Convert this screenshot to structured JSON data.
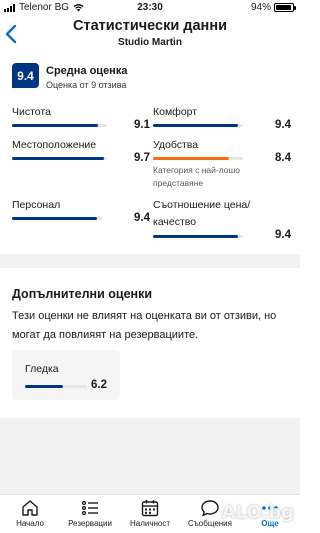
{
  "status_bar": {
    "carrier": "Telenor BG",
    "time": "23:30",
    "battery": "94%",
    "battery_level": 0.94
  },
  "header": {
    "title": "Статистически данни",
    "subtitle": "Studio Martin"
  },
  "average": {
    "score": "9.4",
    "title": "Средна оценка",
    "subtitle": "Оценка от 9 отзива"
  },
  "categories": [
    {
      "label": "Чистота",
      "value": "9.1",
      "fraction": 0.91,
      "color": "#003580"
    },
    {
      "label": "Комфорт",
      "value": "9.4",
      "fraction": 0.94,
      "color": "#003580"
    },
    {
      "label": "Местоположение",
      "value": "9.7",
      "fraction": 0.97,
      "color": "#003580"
    },
    {
      "label": "Удобства",
      "value": "8.4",
      "fraction": 0.84,
      "color": "#f56c15",
      "note": "Категория с най-лошо представяне"
    },
    {
      "label": "Персонал",
      "value": "9.4",
      "fraction": 0.94,
      "color": "#003580"
    },
    {
      "label": "Съотношение цена/качество",
      "value": "9.4",
      "fraction": 0.94,
      "color": "#003580"
    }
  ],
  "additional": {
    "title": "Допълнителни оценки",
    "description": "Тези оценки не влияят на оценката ви от отзиви, но могат да повлияят на резервациите.",
    "items": [
      {
        "label": "Гледка",
        "value": "6.2",
        "fraction": 0.62,
        "color": "#003580"
      }
    ]
  },
  "tabbar": {
    "items": [
      {
        "label": "Начало",
        "icon": "home-icon",
        "active": false
      },
      {
        "label": "Резервации",
        "icon": "list-icon",
        "active": false
      },
      {
        "label": "Наличност",
        "icon": "calendar-icon",
        "active": false
      },
      {
        "label": "Съобщения",
        "icon": "chat-icon",
        "active": false
      },
      {
        "label": "Още",
        "icon": "more-icon",
        "active": true
      }
    ]
  },
  "watermark": "ALO.bg",
  "colors": {
    "brand": "#003580",
    "accent": "#0071c2",
    "warning": "#f56c15"
  }
}
